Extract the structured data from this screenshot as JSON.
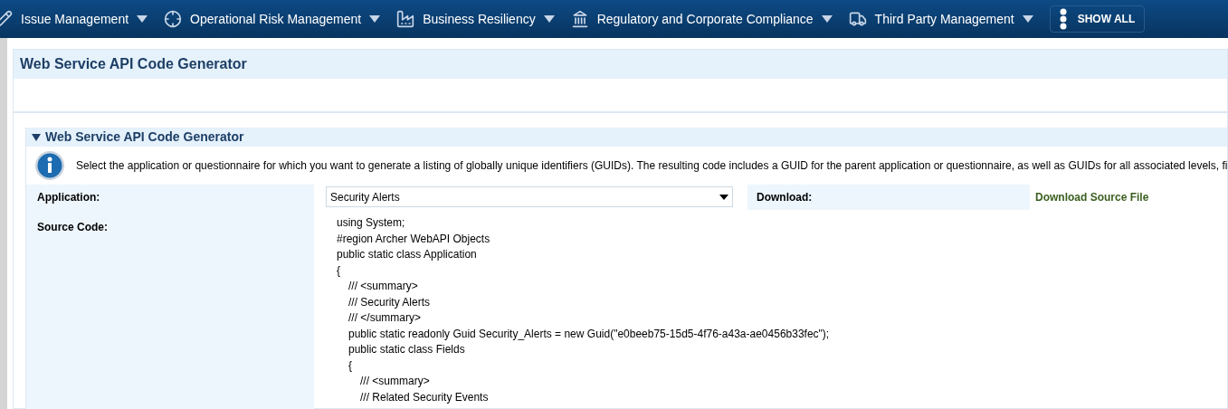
{
  "nav": {
    "items": [
      {
        "label": "Issue Management"
      },
      {
        "label": "Operational Risk Management"
      },
      {
        "label": "Business Resiliency"
      },
      {
        "label": "Regulatory and Corporate Compliance"
      },
      {
        "label": "Third Party Management"
      }
    ],
    "show_all": "SHOW ALL"
  },
  "page_title": "Web Service API Code Generator",
  "section": {
    "title": "Web Service API Code Generator",
    "expanded": true,
    "info": "Select the application or questionnaire for which you want to generate a listing of globally unique identifiers (GUIDs). The resulting code includes a GUID for the parent application or questionnaire, as well as GUIDs for all associated levels, fi",
    "application_label": "Application:",
    "application_value": "Security Alerts",
    "download_label": "Download:",
    "download_link": "Download Source File",
    "source_label": "Source Code:",
    "code": [
      {
        "text": "using System;"
      },
      {
        "text": "#region Archer WebAPI Objects"
      },
      {
        "text": "public static class Application"
      },
      {
        "text": "{",
        "children": [
          {
            "text": "/// <summary>"
          },
          {
            "text": "/// Security Alerts"
          },
          {
            "text": "/// </summary>"
          },
          {
            "text": "public static readonly Guid Security_Alerts = new Guid(\"e0beeb75-15d5-4f76-a43a-ae0456b33fec\");"
          },
          {
            "text": "public static class Fields"
          },
          {
            "text": "{",
            "children": [
              {
                "text": "/// <summary>"
              },
              {
                "text": "/// Related Security Events"
              }
            ]
          }
        ]
      }
    ]
  }
}
